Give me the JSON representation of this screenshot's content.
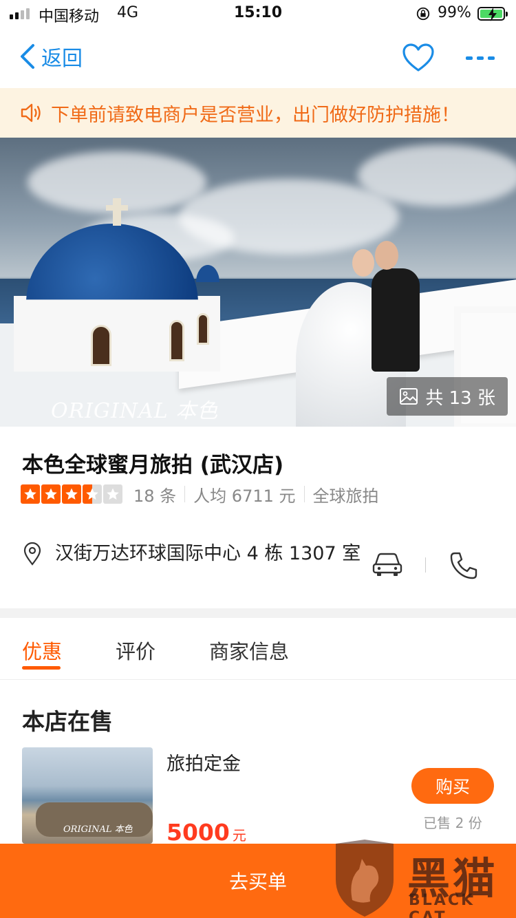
{
  "status_bar": {
    "carrier": "中国移动",
    "network": "4G",
    "time": "15:10",
    "battery": "99%"
  },
  "nav": {
    "back_label": "返回",
    "icons": [
      "chevron-left-icon",
      "heart-icon",
      "more-icon"
    ]
  },
  "notice": {
    "text": "下单前请致电商户是否营业，出门做好防护措施！"
  },
  "hero": {
    "watermark": "ORIGINAL 本色",
    "photo_count": "共 13 张"
  },
  "shop": {
    "title": "本色全球蜜月旅拍 (武汉店)",
    "rating": 3.5,
    "reviews": "18 条",
    "avg_price": "人均 6711 元",
    "category": "全球旅拍",
    "address": "汉街万达环球国际中心 4 栋 1307 室"
  },
  "tabs": [
    {
      "label": "优惠",
      "active": true
    },
    {
      "label": "评价",
      "active": false
    },
    {
      "label": "商家信息",
      "active": false
    }
  ],
  "section": {
    "title": "本店在售"
  },
  "product": {
    "name": "旅拍定金",
    "thumb_watermark": "ORIGINAL 本色",
    "price": "5000",
    "unit": "元",
    "buy_label": "购买",
    "sold": "已售 2 份"
  },
  "bottom_bar": {
    "label": "去买单"
  },
  "brand_overlay": {
    "cn": "黑猫",
    "en": "BLACK CAT"
  },
  "colors": {
    "accent": "#ff6a10",
    "link": "#1a8ce6",
    "notice_bg": "#fdf3e1",
    "price": "#ff3b1f"
  }
}
